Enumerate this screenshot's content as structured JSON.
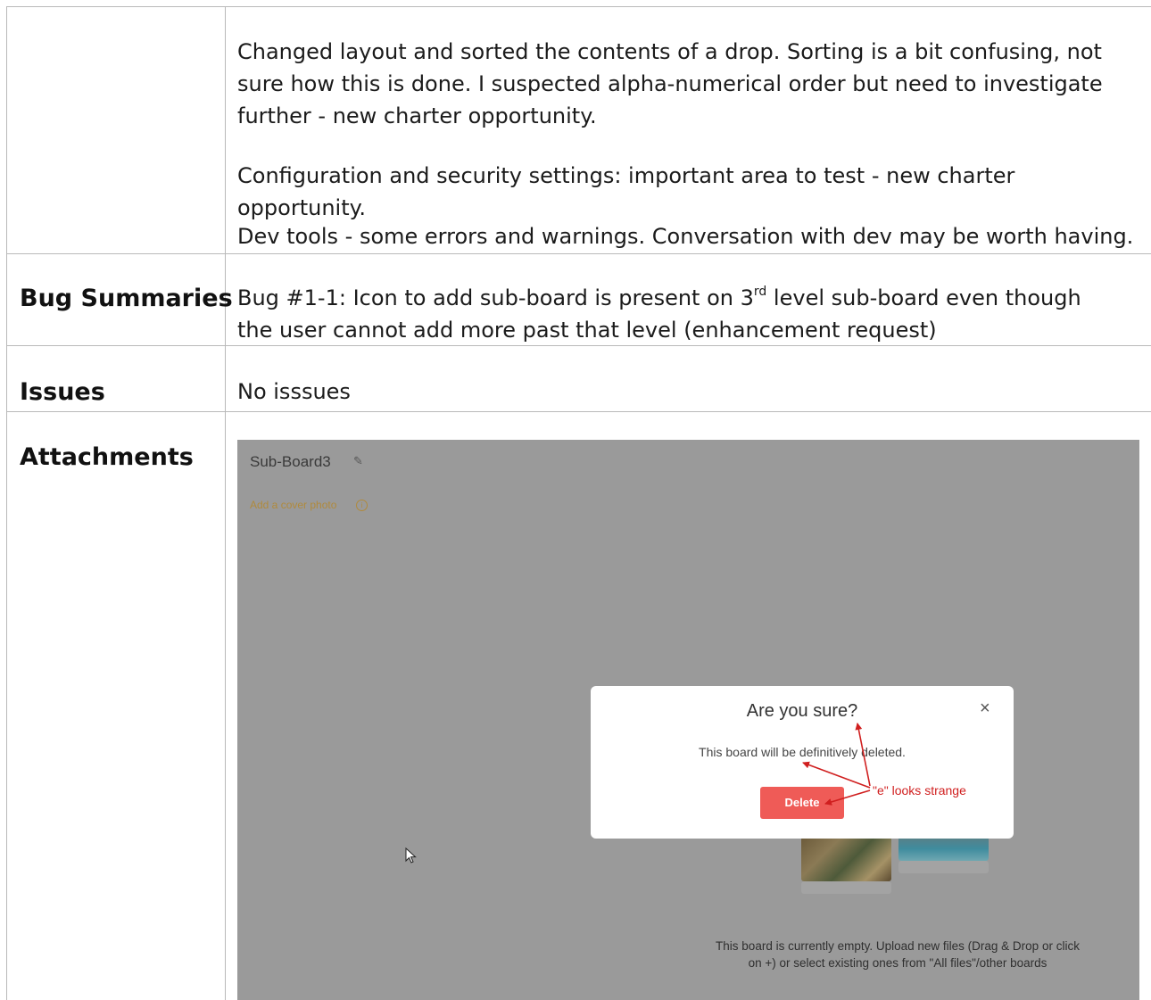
{
  "notes": {
    "paragraph1": "Changed layout and sorted the contents of a drop. Sorting is a bit confusing, not sure how this is done. I suspected alpha-numerical order but need to investigate further - new charter opportunity.",
    "paragraph2": "Configuration and security settings: important area to test - new charter opportunity.",
    "paragraph3": "Dev tools - some errors and warnings. Conversation with dev may be worth having."
  },
  "bug_summaries": {
    "label": "Bug Summaries",
    "text_before": "Bug #1-1: Icon to add sub-board is present on 3",
    "superscript": "rd",
    "text_after": " level sub-board even though the user cannot add more past that level (enhancement request)"
  },
  "issues": {
    "label": "Issues",
    "text": "No isssues"
  },
  "attachments": {
    "label": "Attachments",
    "screenshot": {
      "board_title": "Sub-Board3",
      "cover_photo_link": "Add a cover photo",
      "info_glyph": "i",
      "empty_message_line1": "This board is currently empty. Upload new files (Drag & Drop or click",
      "empty_message_line2": "on +) or select existing ones from \"All files\"/other boards",
      "modal": {
        "title": "Are you sure?",
        "message": "This board will be definitively deleted.",
        "delete_label": "Delete",
        "close_glyph": "×"
      },
      "annotation": "\"e\" looks strange",
      "annotation_color": "#d01f1f",
      "delete_color": "#ef5b57"
    }
  }
}
